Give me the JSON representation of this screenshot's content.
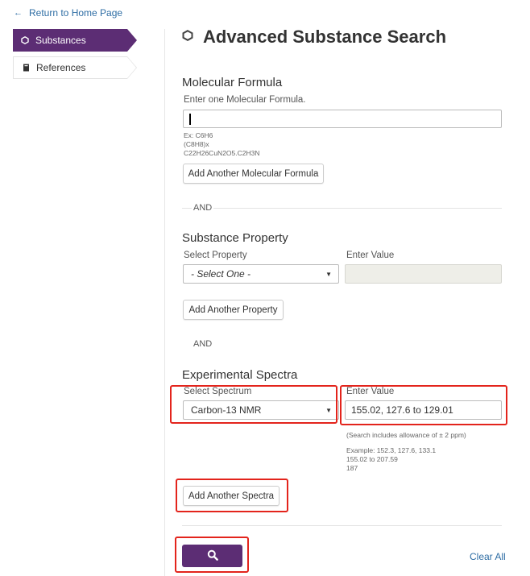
{
  "nav": {
    "back_label": "Return to Home Page",
    "items": [
      {
        "label": "Substances",
        "icon": "hexagon-icon",
        "active": true
      },
      {
        "label": "References",
        "icon": "book-icon",
        "active": false
      }
    ]
  },
  "page": {
    "title": "Advanced Substance Search"
  },
  "molecular_formula": {
    "heading": "Molecular Formula",
    "label": "Enter one Molecular Formula.",
    "value": "",
    "examples": [
      "Ex: C6H6",
      "(C8H8)x",
      "C22H26CuN2O5.C2H3N"
    ],
    "add_button": "Add Another Molecular Formula"
  },
  "and_label": "AND",
  "substance_property": {
    "heading": "Substance Property",
    "select_label": "Select Property",
    "select_value": "- Select One -",
    "value_label": "Enter Value",
    "value": "",
    "add_button": "Add Another Property"
  },
  "experimental_spectra": {
    "heading": "Experimental Spectra",
    "select_label": "Select Spectrum",
    "select_value": "Carbon-13 NMR",
    "value_label": "Enter Value",
    "value": "155.02, 127.6 to 129.01",
    "allowance_note": "(Search includes allowance of ± 2 ppm)",
    "examples": [
      "Example: 152.3, 127.6, 133.1",
      "155.02 to 207.59",
      "187"
    ],
    "add_button": "Add Another Spectra"
  },
  "actions": {
    "search_icon": "search-icon",
    "clear_all": "Clear All"
  },
  "colors": {
    "brand_purple": "#5c2d74",
    "link_blue": "#2e6da4",
    "highlight_red": "#e3241c"
  }
}
